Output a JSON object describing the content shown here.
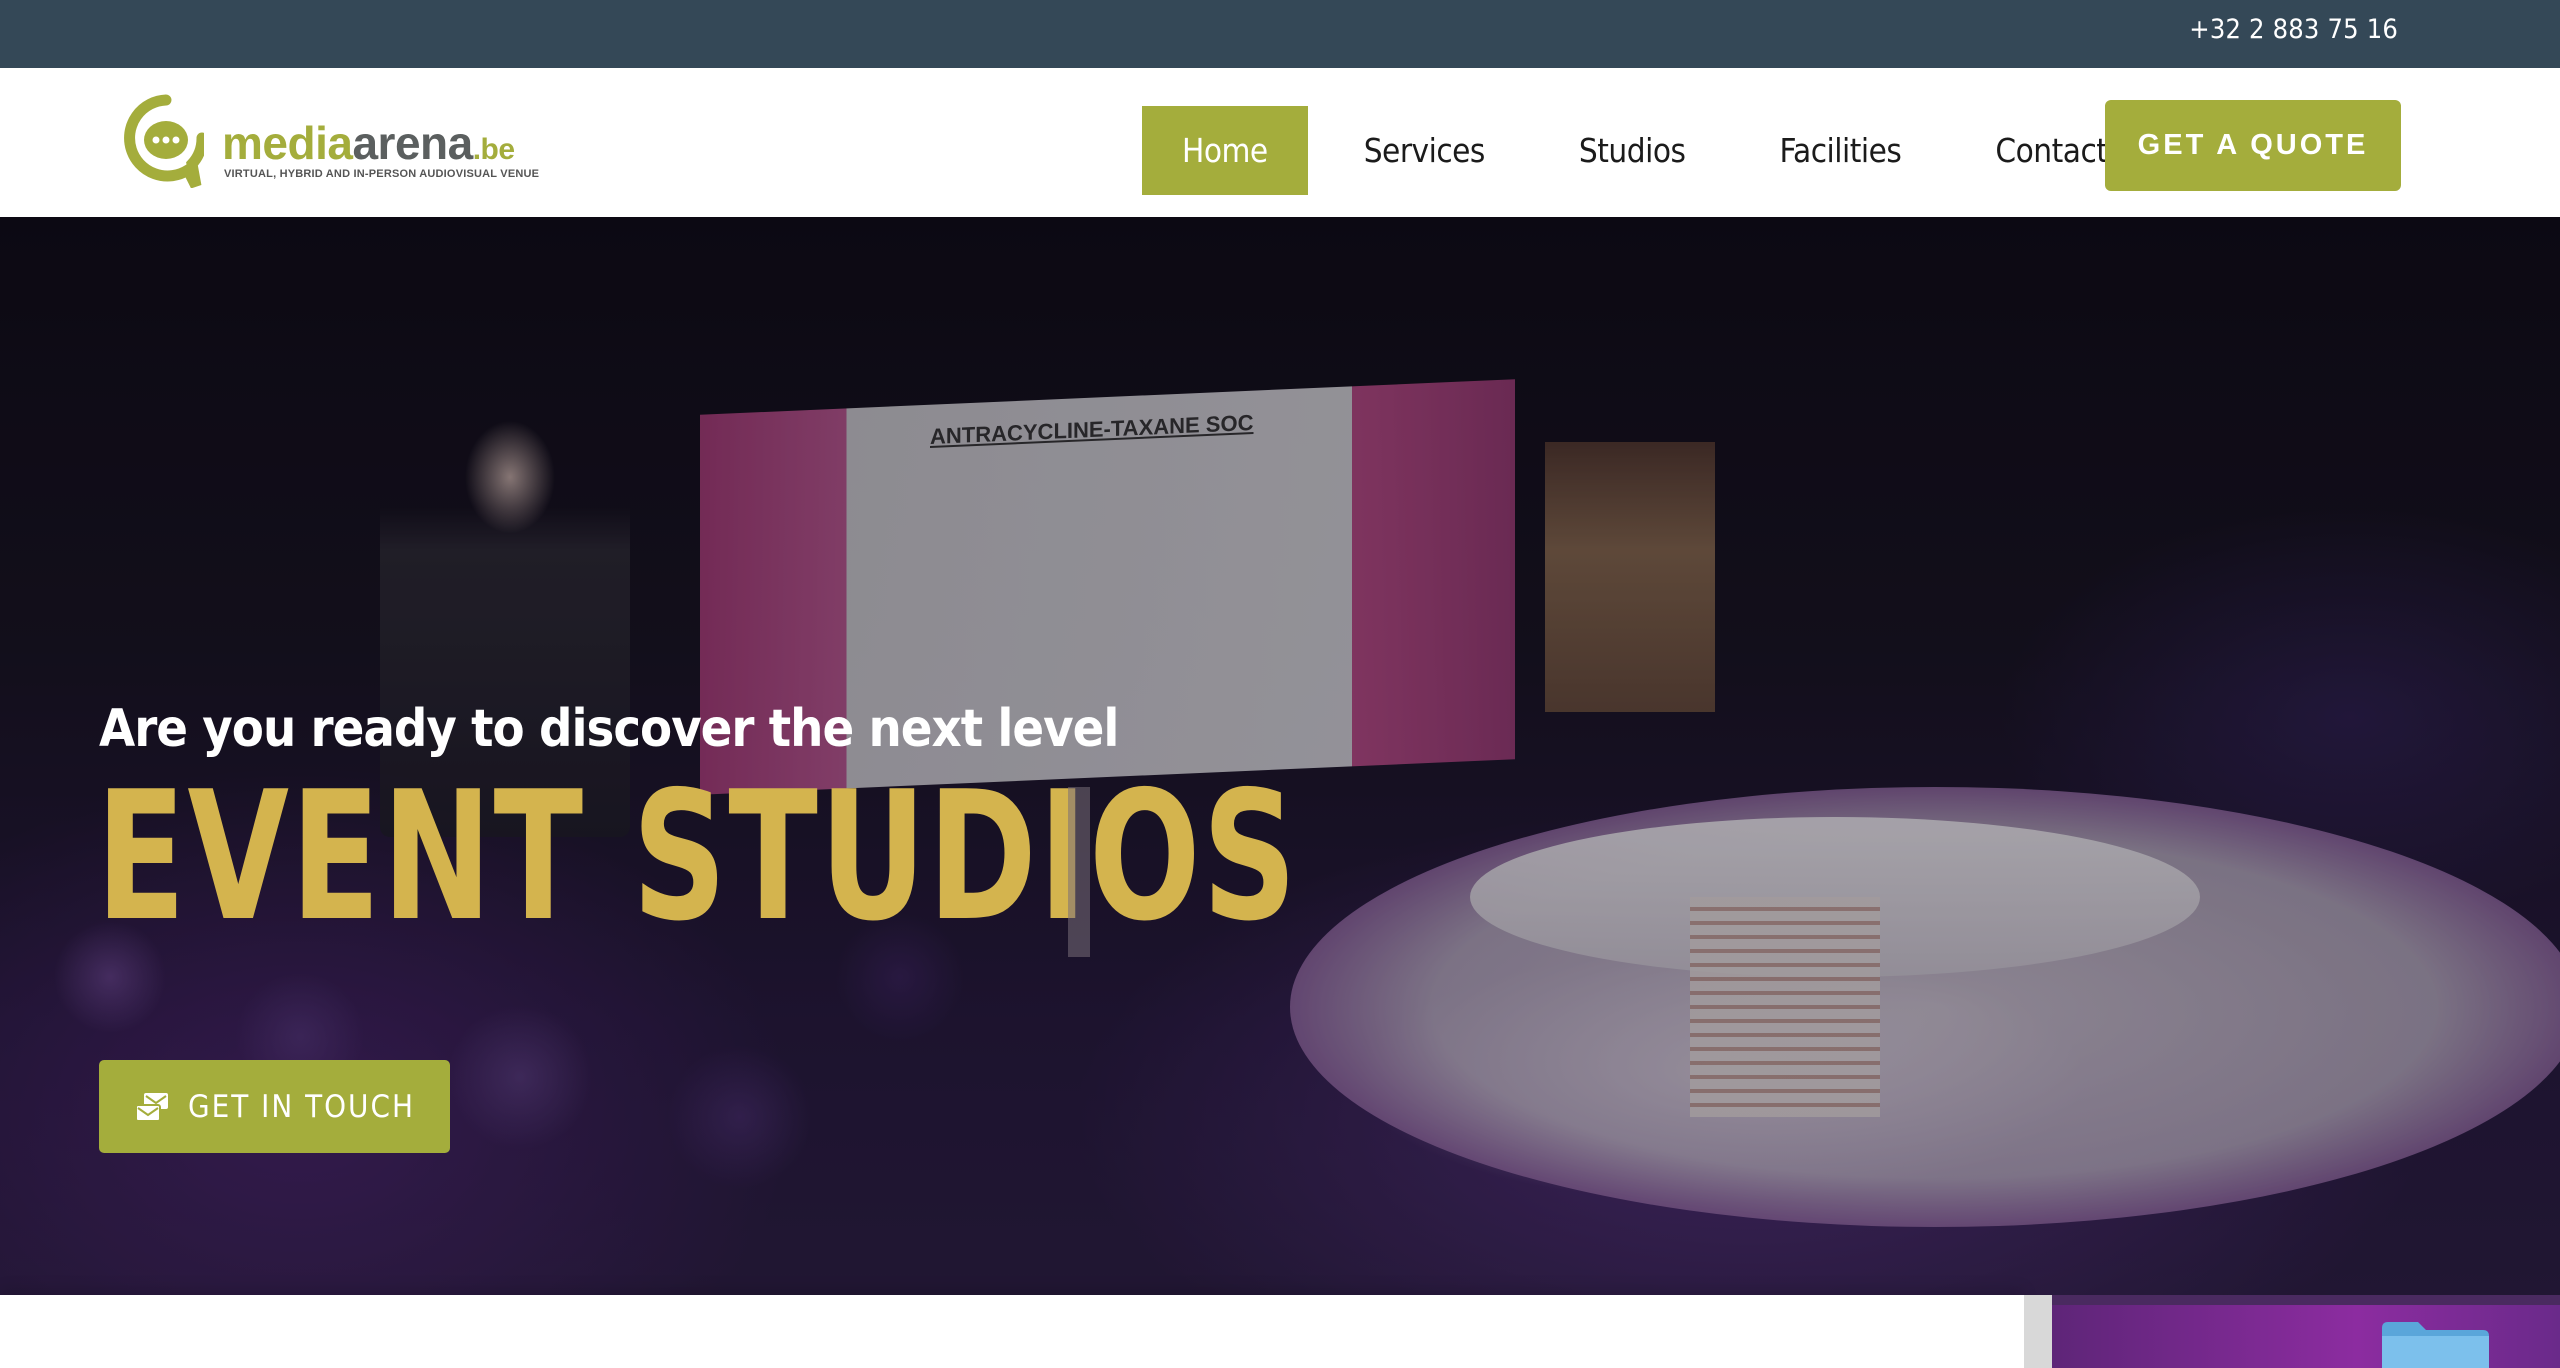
{
  "topbar": {
    "phone": "+32 2 883 75 16"
  },
  "logo": {
    "word_part1": "media",
    "word_part2": "arena",
    "word_part3": ".be",
    "tagline": "VIRTUAL, HYBRID AND IN-PERSON AUDIOVISUAL VENUE",
    "icon": "chat-bubble-logo-icon"
  },
  "nav": {
    "items": [
      {
        "label": "Home",
        "active": true
      },
      {
        "label": "Services",
        "active": false
      },
      {
        "label": "Studios",
        "active": false
      },
      {
        "label": "Facilities",
        "active": false
      },
      {
        "label": "Contact",
        "active": false
      }
    ],
    "quote_label": "GET A QUOTE"
  },
  "hero": {
    "kicker": "Are you ready to discover the next level",
    "title": "EVENT STUDIOS",
    "cta_label": "GET IN TOUCH",
    "cta_icon": "mail-stack-icon",
    "screen_title": "ANTRACYCLINE-TAXANE SOC"
  },
  "colors": {
    "topbar": "#344857",
    "accent": "#a4ad3c",
    "hero_title": "#d4b44e"
  }
}
